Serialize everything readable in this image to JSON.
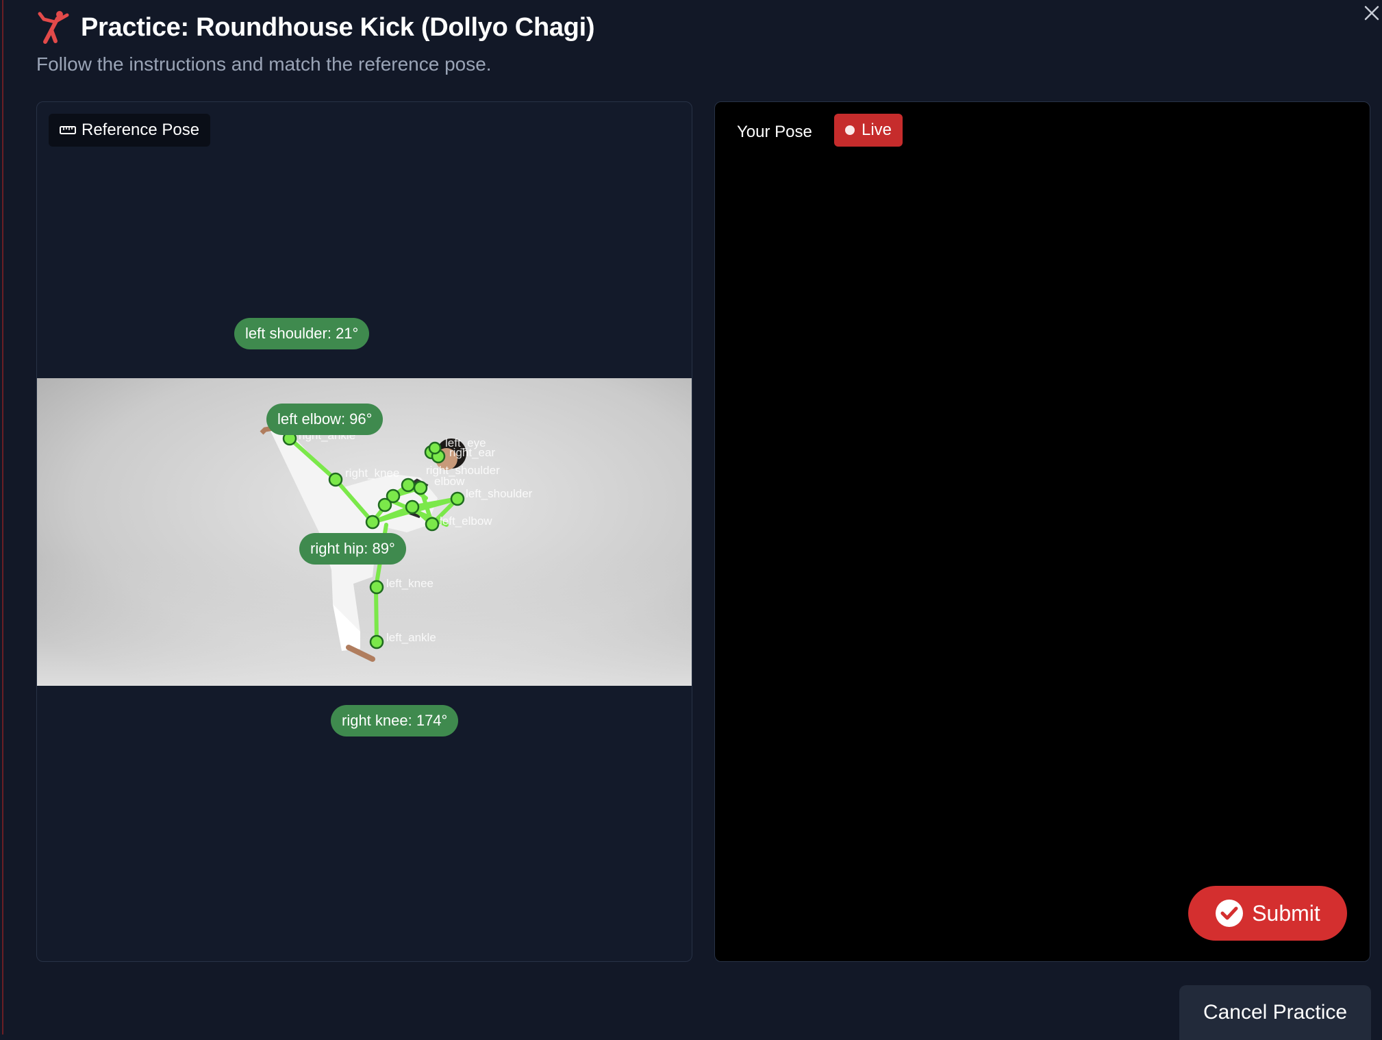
{
  "header": {
    "title": "Practice: Roundhouse Kick (Dollyo Chagi)",
    "subtitle": "Follow the instructions and match the reference pose."
  },
  "reference": {
    "tag_label": "Reference Pose",
    "angles": {
      "left_shoulder": "left shoulder: 21°",
      "left_elbow": "left elbow: 96°",
      "right_hip": "right hip: 89°",
      "right_knee": "right knee: 174°"
    },
    "keypoint_labels": {
      "right_ankle": "right_ankle",
      "right_knee": "right_knee",
      "left_eye": "left_eye",
      "right_ear": "right_ear",
      "right_shoulder": "right_shoulder",
      "elbow": "elbow",
      "left_shoulder": "left_shoulder",
      "left_elbow": "left_elbow",
      "left_knee": "left_knee",
      "left_ankle": "left_ankle"
    }
  },
  "user_pose": {
    "label": "Your Pose",
    "live_label": "Live"
  },
  "actions": {
    "submit_label": "Submit",
    "cancel_label": "Cancel Practice"
  },
  "colors": {
    "accent": "#d42f2f",
    "badge_green": "#3f8a4e",
    "skeleton": "#7be84a",
    "background": "#121827"
  },
  "icons": {
    "app": "kick-icon",
    "close": "close-icon",
    "reference": "ruler-icon",
    "submit": "check-circle-icon"
  }
}
